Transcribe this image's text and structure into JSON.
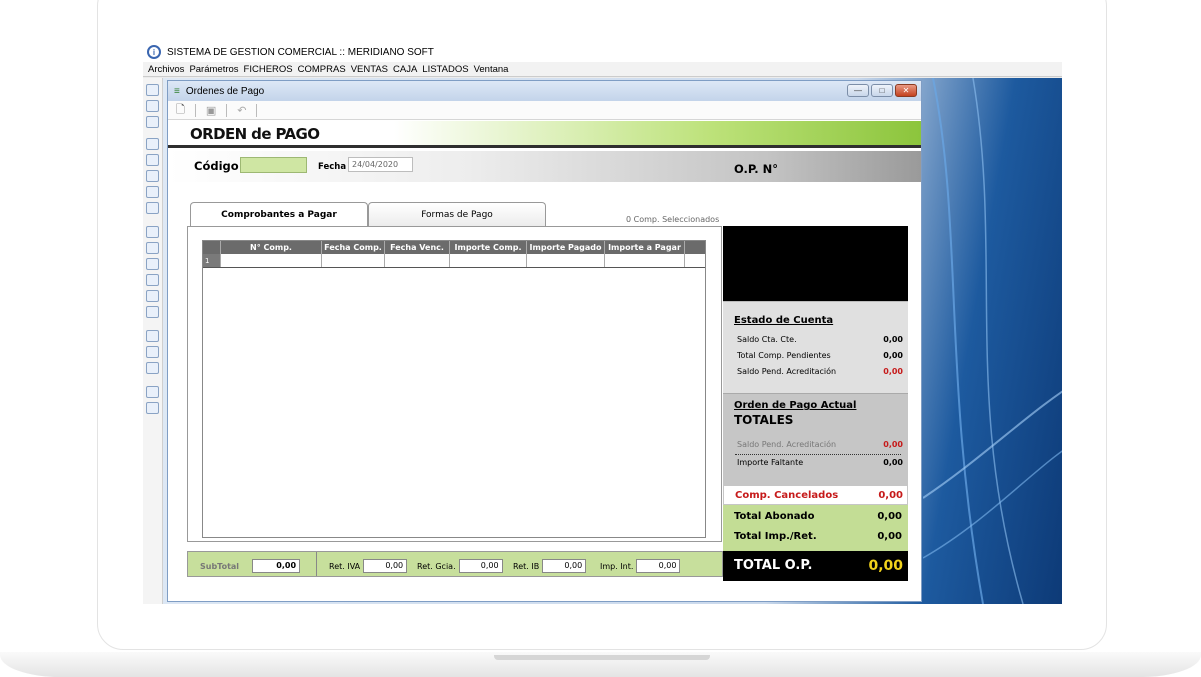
{
  "app": {
    "title": "SISTEMA DE GESTION COMERCIAL :: MERIDIANO SOFT",
    "menu": [
      "Archivos",
      "Parámetros",
      "FICHEROS",
      "COMPRAS",
      "VENTAS",
      "CAJA",
      "LISTADOS",
      "Ventana"
    ]
  },
  "window": {
    "title": "Ordenes de Pago",
    "buttons": {
      "minimize": "—",
      "maximize": "□",
      "close": "✕"
    }
  },
  "form": {
    "heading": "ORDEN de PAGO",
    "codigo_label": "Código",
    "codigo_value": "",
    "fecha_label": "Fecha",
    "fecha_value": "24/04/2020",
    "op_label": "O.P. N°"
  },
  "tabs": [
    {
      "label": "Comprobantes a Pagar",
      "active": true
    },
    {
      "label": "Formas de Pago",
      "active": false
    }
  ],
  "selected_text": "0 Comp. Seleccionados",
  "grid": {
    "columns": [
      "N° Comp.",
      "Fecha Comp.",
      "Fecha Venc.",
      "Importe Comp.",
      "Importe Pagado",
      "Importe a Pagar"
    ],
    "rows": [
      {
        "num": "1",
        "cells": [
          "",
          "",
          "",
          "",
          "",
          ""
        ]
      }
    ]
  },
  "estado_cuenta": {
    "title": "Estado de Cuenta",
    "rows": [
      {
        "label": "Saldo Cta. Cte.",
        "value": "0,00"
      },
      {
        "label": "Total Comp. Pendientes",
        "value": "0,00"
      },
      {
        "label": "Saldo Pend. Acreditación",
        "value": "0,00"
      }
    ]
  },
  "orden_actual": {
    "title": "Orden de Pago Actual",
    "subtitle": "TOTALES",
    "rows": [
      {
        "label": "Saldo Pend. Acreditación",
        "value": "0,00"
      },
      {
        "label": "Importe Faltante",
        "value": "0,00"
      }
    ]
  },
  "summary": {
    "comp_cancelados_label": "Comp. Cancelados",
    "comp_cancelados_value": "0,00",
    "total_abonado_label": "Total  Abonado",
    "total_abonado_value": "0,00",
    "total_imp_label": "Total Imp./Ret.",
    "total_imp_value": "0,00",
    "total_op_label": "TOTAL O.P.",
    "total_op_value": "0,00"
  },
  "bottom": {
    "subtotal_label": "SubTotal",
    "subtotal_value": "0,00",
    "ret_iva_label": "Ret. IVA",
    "ret_iva_value": "0,00",
    "ret_gcia_label": "Ret. Gcia.",
    "ret_gcia_value": "0,00",
    "ret_ib_label": "Ret. IB",
    "ret_ib_value": "0,00",
    "imp_int_label": "Imp. Int.",
    "imp_int_value": "0,00"
  },
  "icons": {
    "app": "meridiano-app-icon",
    "toolbar": [
      "new-document-icon",
      "save-icon",
      "undo-icon"
    ],
    "sidebar_tools": 18
  },
  "colors": {
    "accent_green": "#8cc53c",
    "light_green": "#c3dd95",
    "alert_red": "#c61a1a",
    "total_yellow": "#f2d31b"
  }
}
